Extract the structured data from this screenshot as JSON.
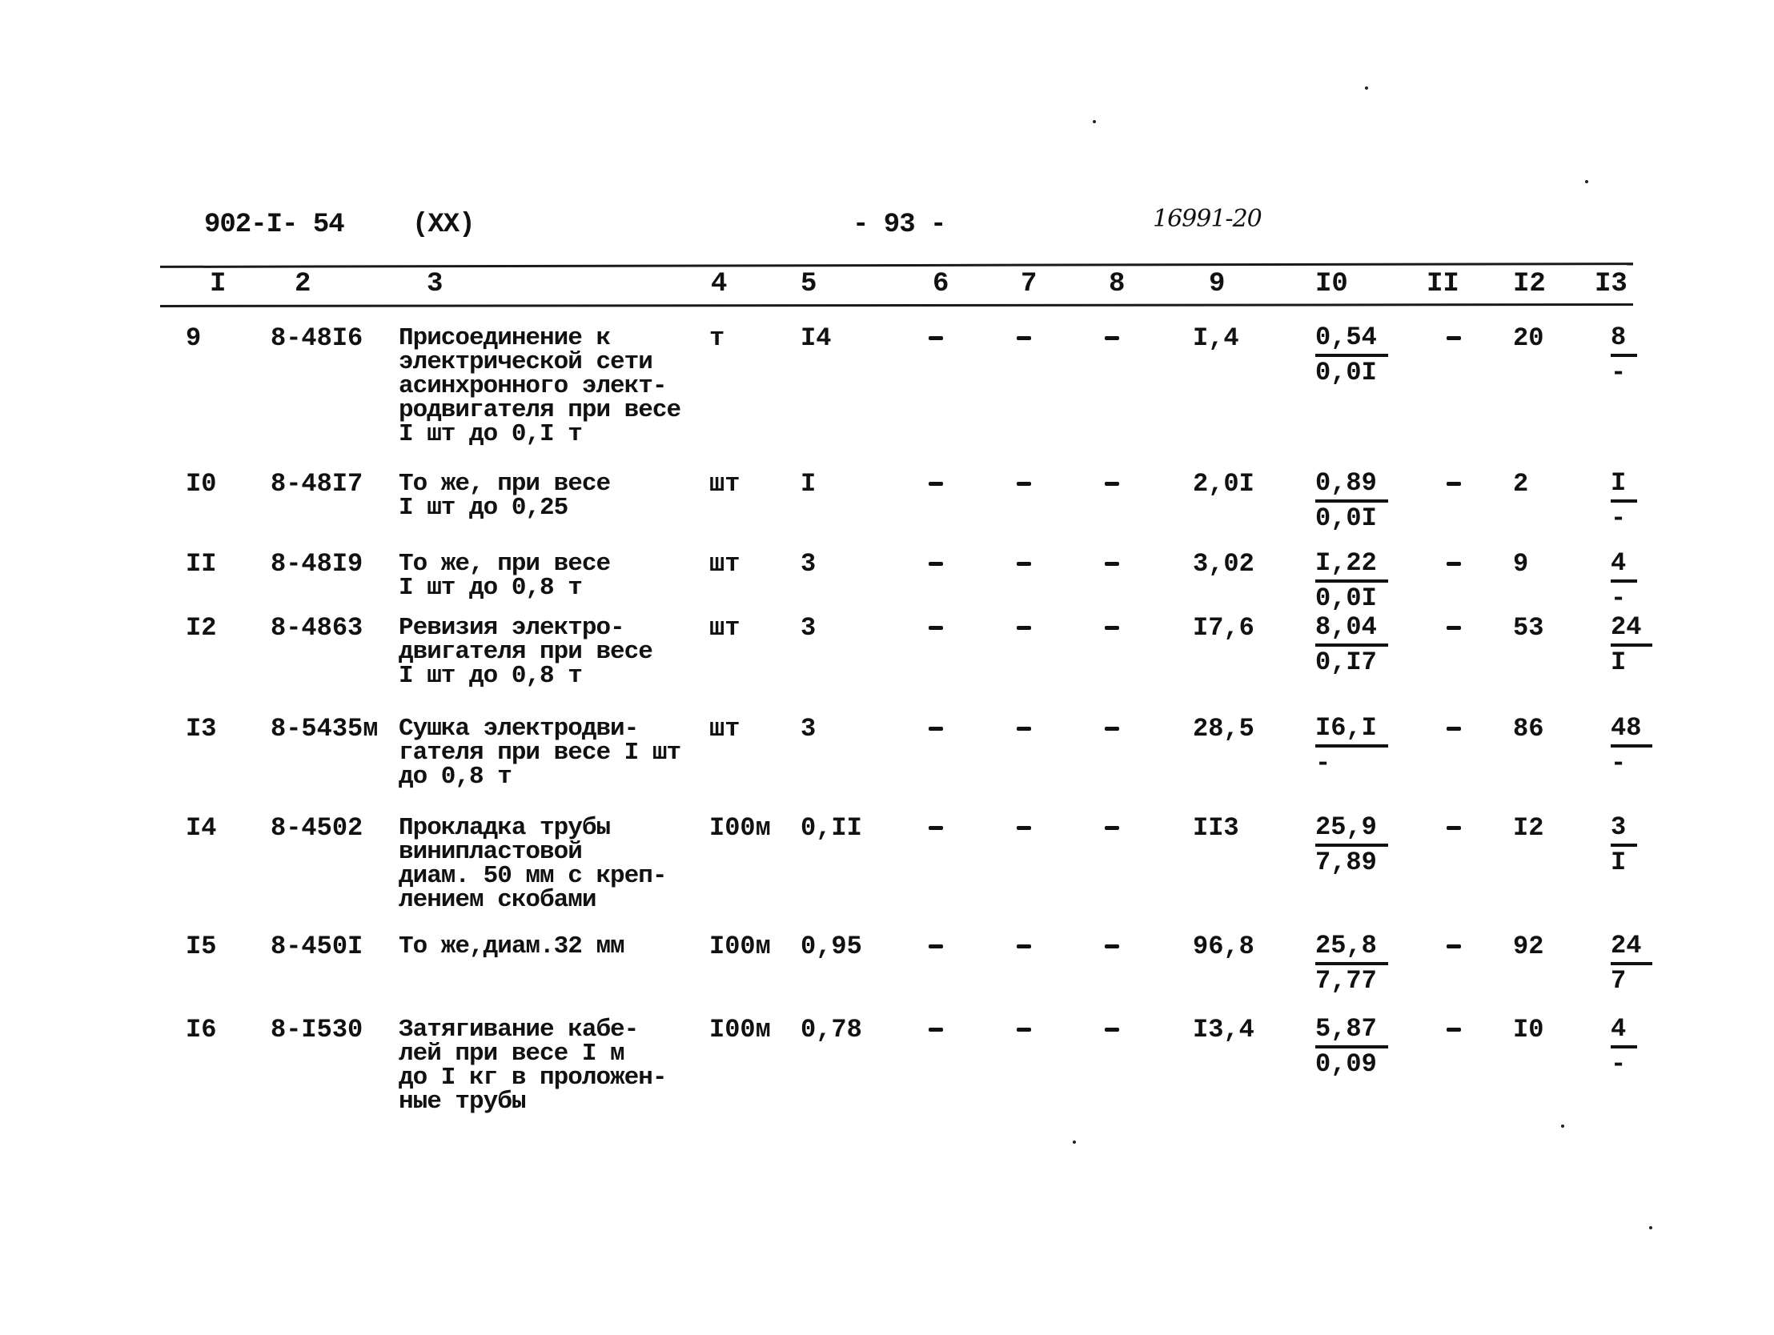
{
  "header": {
    "doc_code": "902-I- 54",
    "section": "(XX)",
    "page_number": "- 93 -",
    "handwritten_number": "16991-20"
  },
  "columns": [
    "I",
    "2",
    "3",
    "4",
    "5",
    "6",
    "7",
    "8",
    "9",
    "I0",
    "II",
    "I2",
    "I3"
  ],
  "rows": [
    {
      "no": "9",
      "code": "8-48I6",
      "description": "Присоединение к\nэлектрической сети\nасинхронного элект-\nродвигателя при весе\nI шт до 0,I т",
      "unit": "т",
      "qty": "I4",
      "c6": "-",
      "c7": "-",
      "c8": "-",
      "c9": "I,4",
      "c10_top": "0,54",
      "c10_bottom": "0,0I",
      "c11": "-",
      "c12": "20",
      "c13_top": "8",
      "c13_bottom": "-"
    },
    {
      "no": "I0",
      "code": "8-48I7",
      "description": "То же, при весе\nI шт до 0,25",
      "unit": "шт",
      "qty": "I",
      "c6": "-",
      "c7": "-",
      "c8": "-",
      "c9": "2,0I",
      "c10_top": "0,89",
      "c10_bottom": "0,0I",
      "c11": "-",
      "c12": "2",
      "c13_top": "I",
      "c13_bottom": "-"
    },
    {
      "no": "II",
      "code": "8-48I9",
      "description": "То же, при весе\nI шт до 0,8 т",
      "unit": "шт",
      "qty": "3",
      "c6": "-",
      "c7": "-",
      "c8": "-",
      "c9": "3,02",
      "c10_top": "I,22",
      "c10_bottom": "0,0I",
      "c11": "-",
      "c12": "9",
      "c13_top": "4",
      "c13_bottom": "-"
    },
    {
      "no": "I2",
      "code": "8-4863",
      "description": "Ревизия электро-\nдвигателя при весе\nI шт до 0,8 т",
      "unit": "шт",
      "qty": "3",
      "c6": "-",
      "c7": "-",
      "c8": "-",
      "c9": "I7,6",
      "c10_top": "8,04",
      "c10_bottom": "0,I7",
      "c11": "-",
      "c12": "53",
      "c13_top": "24",
      "c13_bottom": "I"
    },
    {
      "no": "I3",
      "code": "8-5435м",
      "description": "Сушка электродви-\nгателя при весе I шт\nдо 0,8 т",
      "unit": "шт",
      "qty": "3",
      "c6": "-",
      "c7": "-",
      "c8": "-",
      "c9": "28,5",
      "c10_top": "I6,I",
      "c10_bottom": "-",
      "c11": "-",
      "c12": "86",
      "c13_top": "48",
      "c13_bottom": "-"
    },
    {
      "no": "I4",
      "code": "8-4502",
      "description": "Прокладка трубы\nвинипластовой\nдиам. 50 мм с креп-\nлением скобами",
      "unit": "I00м",
      "qty": "0,II",
      "c6": "-",
      "c7": "-",
      "c8": "-",
      "c9": "II3",
      "c10_top": "25,9",
      "c10_bottom": "7,89",
      "c11": "-",
      "c12": "I2",
      "c13_top": "3",
      "c13_bottom": "I"
    },
    {
      "no": "I5",
      "code": "8-450I",
      "description": "То же,диам.32 мм",
      "unit": "I00м",
      "qty": "0,95",
      "c6": "-",
      "c7": "-",
      "c8": "-",
      "c9": "96,8",
      "c10_top": "25,8",
      "c10_bottom": "7,77",
      "c11": "-",
      "c12": "92",
      "c13_top": "24",
      "c13_bottom": "7"
    },
    {
      "no": "I6",
      "code": "8-I530",
      "description": "Затягивание кабе-\nлей при весе I м\nдо I кг в проложен-\nные трубы",
      "unit": "I00м",
      "qty": "0,78",
      "c6": "-",
      "c7": "-",
      "c8": "-",
      "c9": "I3,4",
      "c10_top": "5,87",
      "c10_bottom": "0,09",
      "c11": "-",
      "c12": "I0",
      "c13_top": "4",
      "c13_bottom": "-"
    }
  ]
}
